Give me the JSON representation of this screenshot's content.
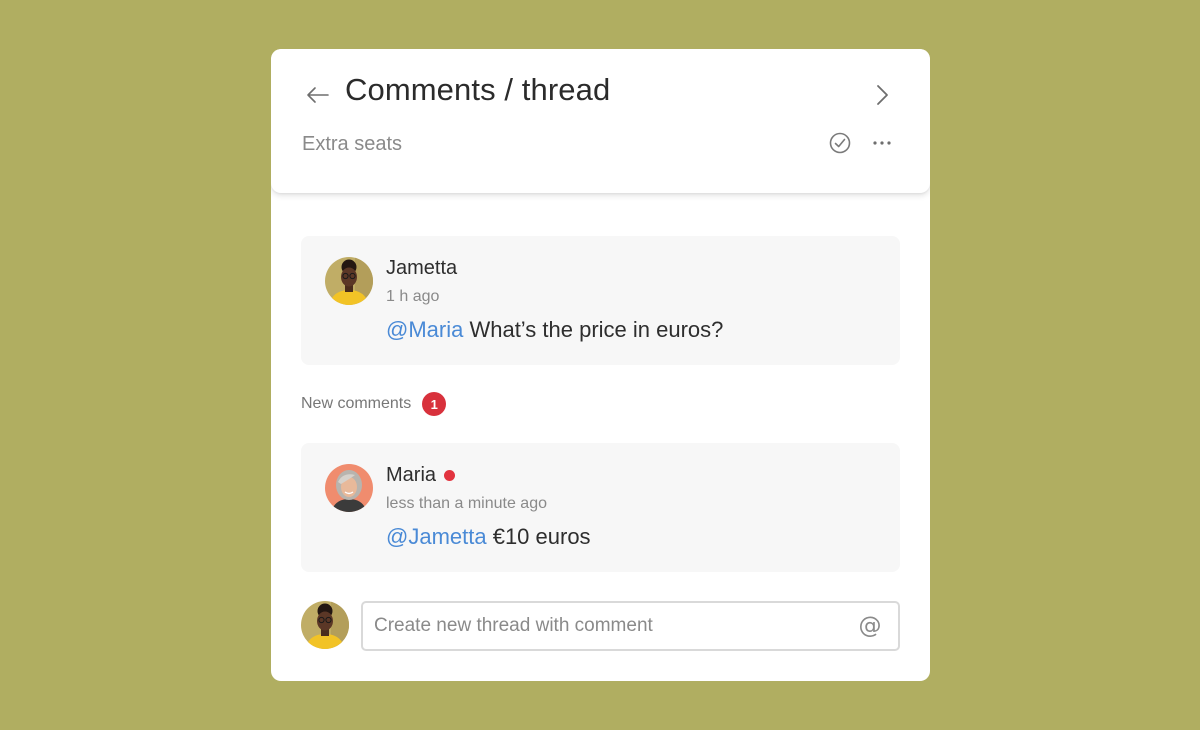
{
  "header": {
    "title": "Comments / thread",
    "subtitle": "Extra seats",
    "back_icon": "arrow-left-icon",
    "next_icon": "chevron-right-icon",
    "resolve_icon": "check-circle-icon",
    "more_icon": "ellipsis-icon"
  },
  "comments": [
    {
      "author": "Jametta",
      "time": "1 h ago",
      "mention": "@Maria",
      "text": " What’s the price in euros?",
      "unread": false
    },
    {
      "author": "Maria",
      "time": "less than a minute ago",
      "mention": "@Jametta",
      "text": " €10 euros",
      "unread": true
    }
  ],
  "new_comments": {
    "label": "New comments",
    "count": "1"
  },
  "composer": {
    "placeholder": "Create new thread with comment",
    "value": "",
    "mention_icon": "at-sign-icon"
  },
  "colors": {
    "background": "#b0ae61",
    "mention": "#4a8ad6",
    "badge": "#d8313c",
    "unread_dot": "#e2343f",
    "card": "#f7f7f7"
  }
}
